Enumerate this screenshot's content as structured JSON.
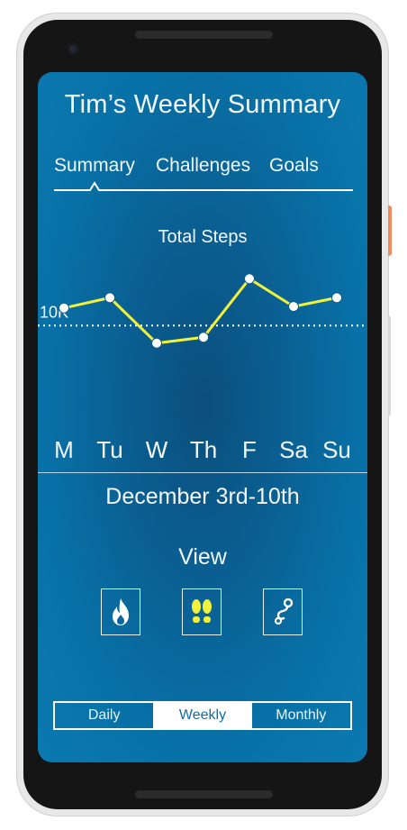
{
  "app": {
    "title": "Tim’s Weekly Summary"
  },
  "tabs": [
    {
      "label": "Summary",
      "active": true
    },
    {
      "label": "Challenges",
      "active": false
    },
    {
      "label": "Goals",
      "active": false
    }
  ],
  "chart_data": {
    "type": "line",
    "title": "Total Steps",
    "categories": [
      "M",
      "Tu",
      "W",
      "Th",
      "F",
      "Sa",
      "Su"
    ],
    "series": [
      {
        "values": [
          11200,
          11900,
          8800,
          9200,
          13200,
          11300,
          11900
        ]
      }
    ],
    "reference_line": {
      "value": 10000,
      "label": "10K",
      "style": "dotted"
    },
    "ylim": [
      7000,
      15000
    ],
    "grid": false,
    "line_color": "#f2f23a"
  },
  "date_range": "December 3rd-10th",
  "view": {
    "label": "View",
    "buttons": [
      {
        "icon": "flame-icon",
        "color": "#ffffff"
      },
      {
        "icon": "footprints-icon",
        "color": "#f2f23a"
      },
      {
        "icon": "route-pin-icon",
        "color": "#ffffff"
      }
    ]
  },
  "period_selector": {
    "options": [
      "Daily",
      "Weekly",
      "Monthly"
    ],
    "selected": "Weekly"
  }
}
